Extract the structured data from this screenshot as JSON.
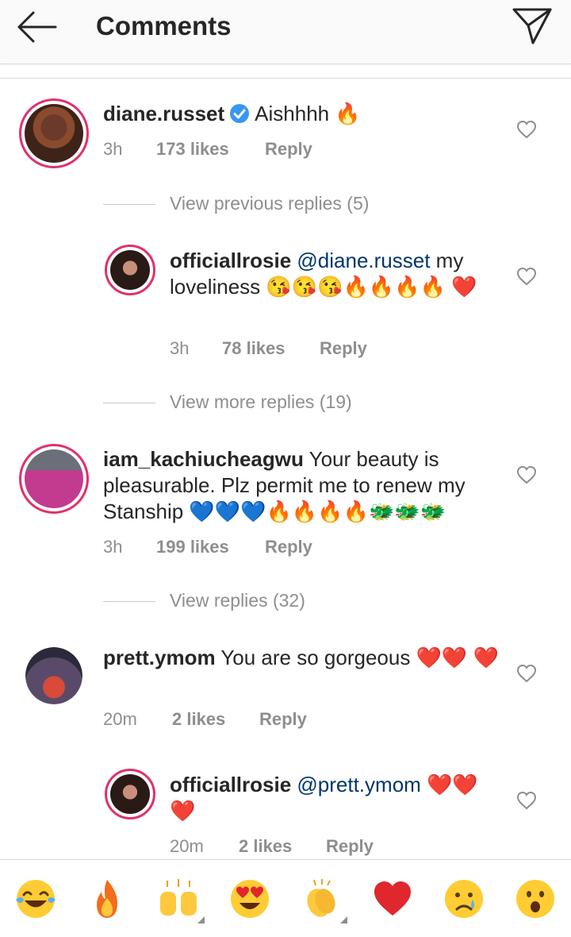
{
  "header": {
    "title": "Comments"
  },
  "view_rows": {
    "previous": "View previous replies (5)",
    "more": "View more replies (19)",
    "replies": "View replies (32)"
  },
  "comments": [
    {
      "username": "diane.russet",
      "verified": true,
      "text": "Aishhhh 🔥",
      "time": "3h",
      "likes": "173 likes",
      "reply": "Reply"
    },
    {
      "username": "officiallrosie",
      "mention": "@diane.russet",
      "text": " my loveliness 😘😘😘🔥🔥🔥🔥 ❤️",
      "time": "3h",
      "likes": "78 likes",
      "reply": "Reply"
    },
    {
      "username": "iam_kachiucheagwu",
      "text": " Your beauty is pleasurable. Plz permit me to renew my Stanship 💙💙💙🔥🔥🔥🔥🐲🐲🐲",
      "time": "3h",
      "likes": "199 likes",
      "reply": "Reply"
    },
    {
      "username": "prett.ymom",
      "text": " You are so gorgeous ❤️❤️ ❤️",
      "time": "20m",
      "likes": "2 likes",
      "reply": "Reply"
    },
    {
      "username": "officiallrosie",
      "mention": "@prett.ymom",
      "text": " ❤️❤️ ❤️",
      "time": "20m",
      "likes": "2 likes",
      "reply": "Reply"
    }
  ],
  "emoji_bar": [
    "😂",
    "🔥",
    "🙌",
    "😍",
    "👏",
    "❤️",
    "😢",
    "😮"
  ],
  "colors": {
    "story_ring": "#e1306c",
    "verified": "#3897f0",
    "mention": "#00376b",
    "heart_red": "#e0272e",
    "muted": "#8e8e8e"
  }
}
